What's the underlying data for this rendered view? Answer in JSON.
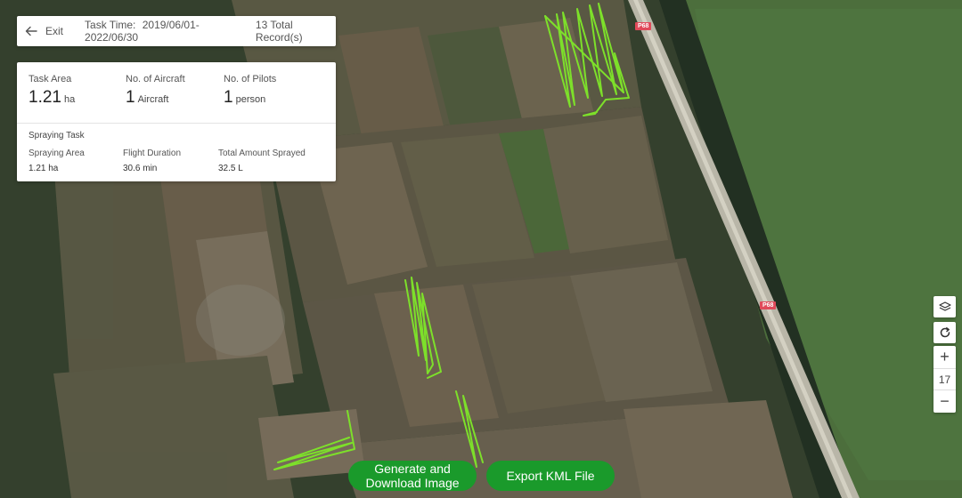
{
  "header": {
    "back_label": "Exit",
    "task_time_label": "Task Time:",
    "task_time_value": "2019/06/01-2022/06/30",
    "records": "13 Total Record(s)"
  },
  "stats": {
    "task_area": {
      "label": "Task Area",
      "value": "1.21",
      "unit": "ha"
    },
    "aircraft": {
      "label": "No. of Aircraft",
      "value": "1",
      "unit": "Aircraft"
    },
    "pilots": {
      "label": "No. of Pilots",
      "value": "1",
      "unit": "person"
    },
    "spraying_title": "Spraying Task",
    "spraying_area": {
      "label": "Spraying Area",
      "value": "1.21 ha"
    },
    "flight_duration": {
      "label": "Flight Duration",
      "value": "30.6 min"
    },
    "total_sprayed": {
      "label": "Total Amount Sprayed",
      "value": "32.5 L"
    }
  },
  "map": {
    "road_label": "P68",
    "zoom_level": "17",
    "zoom_in": "+",
    "zoom_out": "−",
    "layers_icon": "layers-icon",
    "refresh_icon": "refresh-icon",
    "flight_path_color": "#7de02a"
  },
  "actions": {
    "generate_image": "Generate and Download Image",
    "export_kml": "Export KML File"
  },
  "colors": {
    "accent": "#1a9a2b"
  }
}
